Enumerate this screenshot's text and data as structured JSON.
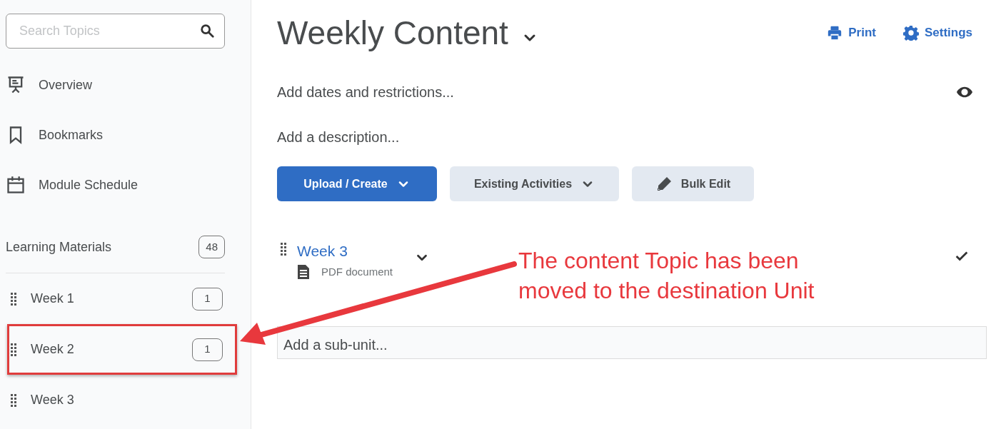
{
  "sidebar": {
    "search": {
      "placeholder": "Search Topics"
    },
    "nav_items": [
      {
        "kind": "overview",
        "label": "Overview"
      },
      {
        "kind": "bookmarks",
        "label": "Bookmarks"
      },
      {
        "kind": "schedule",
        "label": "Module Schedule"
      }
    ],
    "module": {
      "label": "Learning Materials",
      "count": "48"
    },
    "units": [
      {
        "label": "Week 1",
        "count": "1",
        "highlighted": false
      },
      {
        "label": "Week 2",
        "count": "1",
        "highlighted": true
      },
      {
        "label": "Week 3",
        "highlighted": false
      }
    ]
  },
  "main": {
    "title": "Weekly Content",
    "actions": [
      {
        "kind": "print",
        "label": "Print"
      },
      {
        "kind": "settings",
        "label": "Settings"
      }
    ],
    "dates_link": "Add dates and restrictions...",
    "description_link": "Add a description...",
    "buttons": [
      {
        "kind": "primary",
        "label": "Upload / Create",
        "dropdown": true
      },
      {
        "kind": "secondary",
        "label": "Existing Activities",
        "dropdown": true
      },
      {
        "kind": "edit",
        "label": "Bulk Edit",
        "dropdown": false
      }
    ],
    "topics": [
      {
        "title": "Week 3",
        "type": "PDF document",
        "completed": true
      }
    ],
    "subunit": {
      "placeholder": "Add a sub-unit..."
    }
  },
  "annotation": {
    "text": "The content Topic has been moved to the destination Unit"
  }
}
